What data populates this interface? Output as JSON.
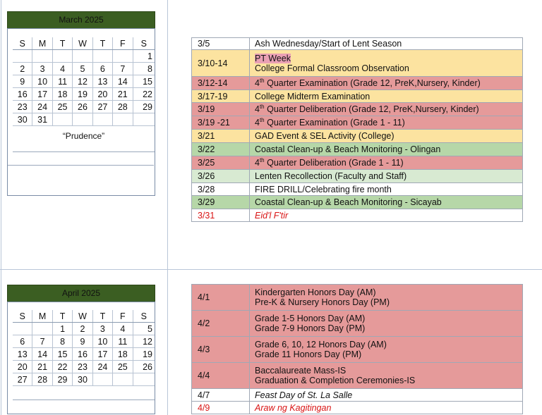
{
  "march": {
    "title": "March 2025",
    "dow": [
      "S",
      "M",
      "T",
      "W",
      "T",
      "F",
      "S"
    ],
    "weeks": [
      [
        "",
        "",
        "",
        "",
        "",
        "",
        "1"
      ],
      [
        "2",
        "3",
        "4",
        "5",
        "6",
        "7",
        "8"
      ],
      [
        "9",
        "10",
        "11",
        "12",
        "13",
        "14",
        "15"
      ],
      [
        "16",
        "17",
        "18",
        "19",
        "20",
        "21",
        "22"
      ],
      [
        "23",
        "24",
        "25",
        "26",
        "27",
        "28",
        "29"
      ],
      [
        "30",
        "31",
        "",
        "",
        "",
        "",
        ""
      ]
    ],
    "motto": "“Prudence”",
    "events": [
      {
        "date": "3/5",
        "lines": [
          "Ash Wednesday/Start of Lent Season"
        ]
      },
      {
        "date": "3/10-14",
        "lines": [
          "PT Week",
          "College Formal Classroom Observation"
        ]
      },
      {
        "date": "3/12-14",
        "pre": "4",
        "sup": "th",
        "post": " Quarter Examination (Grade 12, PreK,Nursery, Kinder)"
      },
      {
        "date": "3/17-19",
        "lines": [
          "College Midterm Examination"
        ]
      },
      {
        "date": "3/19",
        "pre": "4",
        "sup": "th",
        "post": " Quarter Deliberation (Grade 12, PreK,Nursery, Kinder)"
      },
      {
        "date": "3/19 -21",
        "pre": "4",
        "sup": "th",
        "post": " Quarter Examination (Grade 1 - 11)"
      },
      {
        "date": "3/21",
        "lines": [
          "GAD Event & SEL Activity (College)"
        ]
      },
      {
        "date": "3/22",
        "lines": [
          "Coastal Clean-up & Beach Monitoring - Olingan"
        ]
      },
      {
        "date": "3/25",
        "pre": "4",
        "sup": "th",
        "post": " Quarter Deliberation (Grade 1 - 11)"
      },
      {
        "date": "3/26",
        "lines": [
          "Lenten Recollection (Faculty and Staff)"
        ]
      },
      {
        "date": "3/28",
        "lines": [
          "FIRE DRILL/Celebrating fire month"
        ]
      },
      {
        "date": "3/29",
        "lines": [
          "Coastal Clean-up & Beach Monitoring - Sicayab"
        ]
      },
      {
        "date": "3/31",
        "lines": [
          "Eid'l F'tir"
        ]
      }
    ]
  },
  "april": {
    "title": "April 2025",
    "dow": [
      "S",
      "M",
      "T",
      "W",
      "T",
      "F",
      "S"
    ],
    "weeks": [
      [
        "",
        "",
        "1",
        "2",
        "3",
        "4",
        "5"
      ],
      [
        "6",
        "7",
        "8",
        "9",
        "10",
        "11",
        "12"
      ],
      [
        "13",
        "14",
        "15",
        "16",
        "17",
        "18",
        "19"
      ],
      [
        "20",
        "21",
        "22",
        "23",
        "24",
        "25",
        "26"
      ],
      [
        "27",
        "28",
        "29",
        "30",
        "",
        "",
        ""
      ]
    ],
    "events": [
      {
        "date": "4/1",
        "lines": [
          "Kindergarten Honors Day (AM)",
          "Pre-K & Nursery Honors Day (PM)"
        ]
      },
      {
        "date": "4/2",
        "lines": [
          "Grade 1-5 Honors Day (AM)",
          "Grade 7-9 Honors Day (PM)"
        ]
      },
      {
        "date": "4/3",
        "lines": [
          "Grade 6, 10, 12 Honors Day (AM)",
          "Grade 11 Honors Day (PM)"
        ]
      },
      {
        "date": "4/4",
        "lines": [
          "Baccalaureate Mass-IS",
          "Graduation & Completion Ceremonies-IS"
        ]
      },
      {
        "date": "4/7",
        "lines": [
          "Feast Day of St. La Salle"
        ]
      },
      {
        "date": "4/9",
        "lines": [
          "Araw ng Kagitingan"
        ]
      }
    ]
  },
  "colors": {
    "header_green": "#3b5e22",
    "rose": "#e59a9a",
    "yellow": "#fce3a0",
    "green": "#b6d7a8",
    "light_green": "#d8ead2",
    "holiday_red": "#d91414"
  }
}
